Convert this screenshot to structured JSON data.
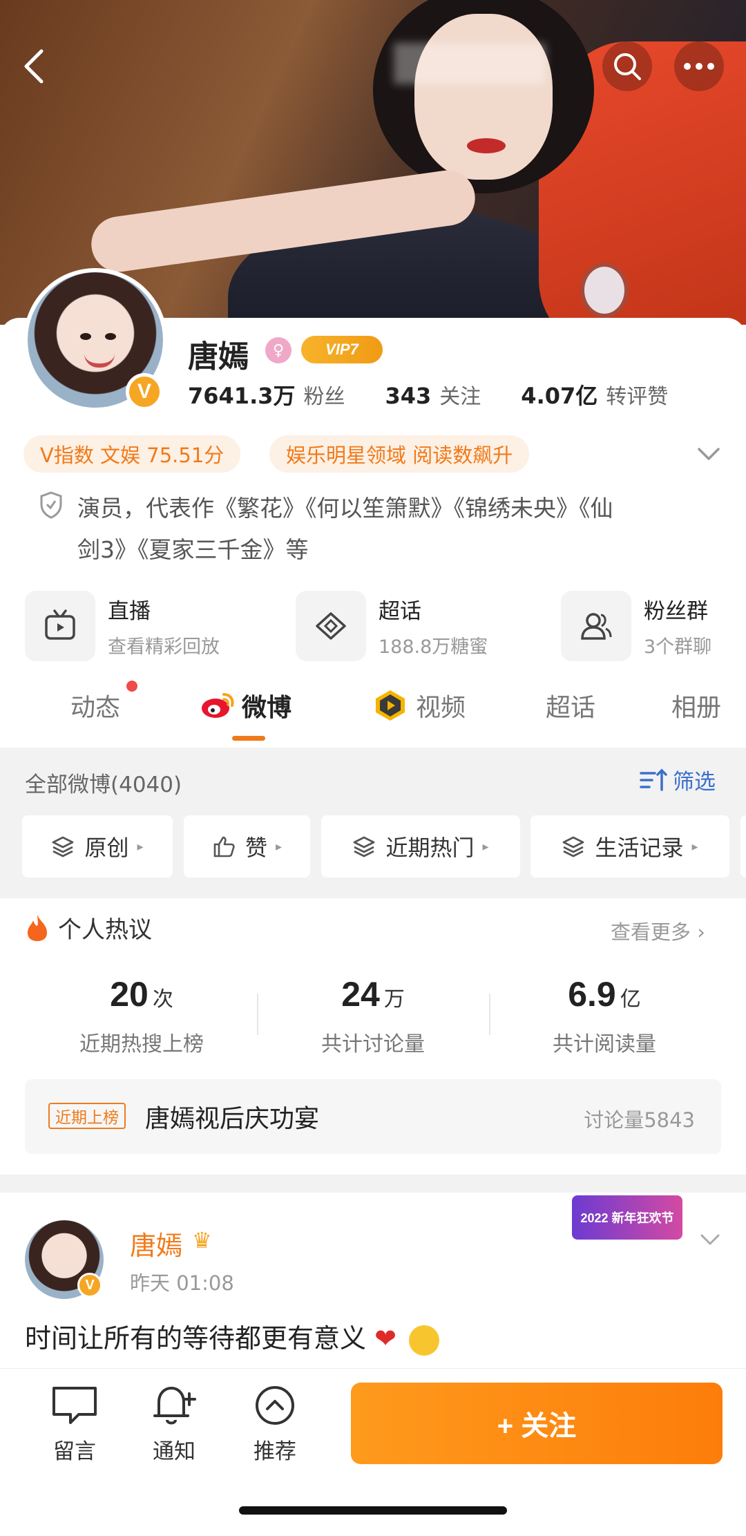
{
  "profile": {
    "name": "唐嫣",
    "vip_label": "VIP7",
    "verified_label": "V",
    "stats": [
      {
        "value": "7641.3万",
        "label": "粉丝"
      },
      {
        "value": "343",
        "label": "关注"
      },
      {
        "value": "4.07亿",
        "label": "转评赞"
      }
    ],
    "pills": [
      "V指数 文娱 75.51分",
      "娱乐明星领域 阅读数飙升"
    ],
    "bio_line1": "演员，代表作《繁花》《何以笙箫默》《锦绣未央》《仙",
    "bio_line2": "剑3》《夏家三千金》等"
  },
  "features": [
    {
      "title": "直播",
      "subtitle": "查看精彩回放",
      "icon": "tv-icon"
    },
    {
      "title": "超话",
      "subtitle": "188.8万糖蜜",
      "icon": "diamond-icon"
    },
    {
      "title": "粉丝群",
      "subtitle": "3个群聊",
      "icon": "group-icon"
    }
  ],
  "tabs": [
    "动态",
    "微博",
    "视频",
    "超话",
    "相册"
  ],
  "filters": {
    "all_weibo": "全部微博(4040)",
    "filter_label": "筛选",
    "chips": [
      "原创",
      "赞",
      "近期热门",
      "生活记录"
    ]
  },
  "hot": {
    "title": "个人热议",
    "see_more": "查看更多",
    "stats": [
      {
        "value": "20",
        "unit": "次",
        "label": "近期热搜上榜"
      },
      {
        "value": "24",
        "unit": "万",
        "label": "共计讨论量"
      },
      {
        "value": "6.9",
        "unit": "亿",
        "label": "共计阅读量"
      }
    ],
    "item": {
      "tag": "近期上榜",
      "text": "唐嫣视后庆功宴",
      "count": "讨论量5843"
    }
  },
  "post": {
    "author": "唐嫣",
    "time": "昨天 01:08",
    "text": "时间让所有的等待都更有意义",
    "festival_label": "2022 新年狂欢节"
  },
  "bottom_bar": {
    "items": [
      "留言",
      "通知",
      "推荐"
    ],
    "follow_label": "+ 关注"
  },
  "colors": {
    "accent": "#f07a1a",
    "link_blue": "#3b6fcc",
    "follow_gradient_start": "#fe9a1d",
    "follow_gradient_end": "#fd7d0a"
  }
}
